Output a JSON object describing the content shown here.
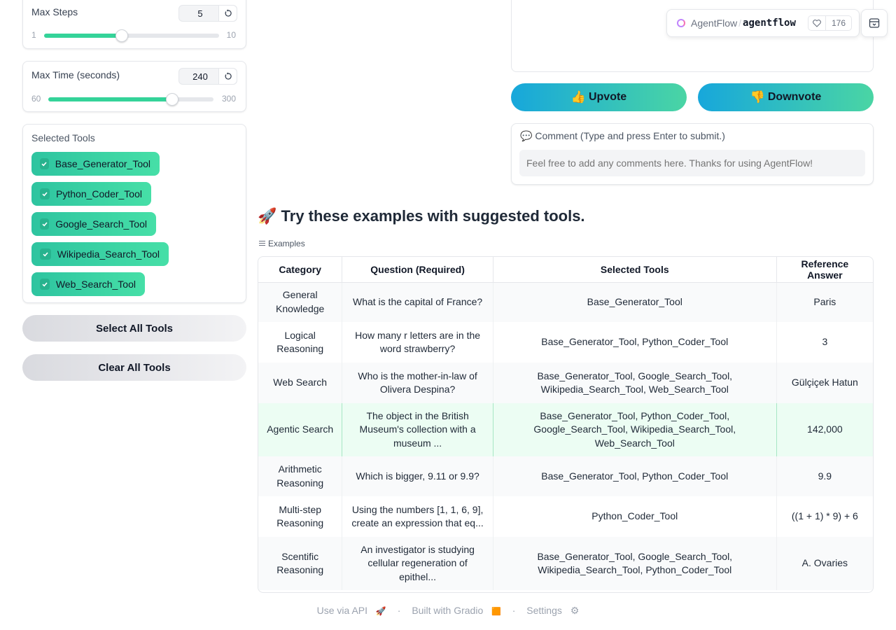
{
  "max_steps": {
    "label": "Max Steps",
    "value": "5",
    "min": "1",
    "max": "10",
    "fraction": 0.444
  },
  "max_time": {
    "label": "Max Time (seconds)",
    "value": "240",
    "min": "60",
    "max": "300",
    "fraction": 0.75
  },
  "tools": {
    "label": "Selected Tools",
    "items": [
      "Base_Generator_Tool",
      "Python_Coder_Tool",
      "Google_Search_Tool",
      "Wikipedia_Search_Tool",
      "Web_Search_Tool"
    ]
  },
  "buttons": {
    "select_all": "Select All Tools",
    "clear_all": "Clear All Tools"
  },
  "header": {
    "org": "AgentFlow",
    "separator": "/",
    "repo": "agentflow",
    "likes": "176"
  },
  "vote": {
    "upvote_emoji": "👍",
    "upvote": "Upvote",
    "downvote_emoji": "👎",
    "downvote": "Downvote"
  },
  "comment": {
    "emoji": "💬",
    "label": "Comment (Type and press Enter to submit.)",
    "placeholder": "Feel free to add any comments here. Thanks for using AgentFlow!"
  },
  "examples": {
    "emoji": "🚀",
    "heading": "Try these examples with suggested tools.",
    "tab_label": "Examples",
    "columns": [
      "Category",
      "Question (Required)",
      "Selected Tools",
      "Reference Answer"
    ],
    "rows": [
      {
        "category": "General Knowledge",
        "question": "What is the capital of France?",
        "tools": "Base_Generator_Tool",
        "answer": "Paris"
      },
      {
        "category": "Logical Reasoning",
        "question": "How many r letters are in the word strawberry?",
        "tools": "Base_Generator_Tool, Python_Coder_Tool",
        "answer": "3"
      },
      {
        "category": "Web Search",
        "question": "Who is the mother-in-law of Olivera Despina?",
        "tools": "Base_Generator_Tool, Google_Search_Tool, Wikipedia_Search_Tool, Web_Search_Tool",
        "answer": "Gülçiçek Hatun"
      },
      {
        "category": "Agentic Search",
        "question": "The object in the British Museum's collection with a museum ...",
        "tools": "Base_Generator_Tool, Python_Coder_Tool, Google_Search_Tool, Wikipedia_Search_Tool, Web_Search_Tool",
        "answer": "142,000"
      },
      {
        "category": "Arithmetic Reasoning",
        "question": "Which is bigger, 9.11 or 9.9?",
        "tools": "Base_Generator_Tool, Python_Coder_Tool",
        "answer": "9.9"
      },
      {
        "category": "Multi-step Reasoning",
        "question": "Using the numbers [1, 1, 6, 9], create an expression that eq...",
        "tools": "Python_Coder_Tool",
        "answer": "((1 + 1) * 9) + 6"
      },
      {
        "category": "Scentific Reasoning",
        "question": "An investigator is studying cellular regeneration of epithel...",
        "tools": "Base_Generator_Tool, Google_Search_Tool, Wikipedia_Search_Tool, Python_Coder_Tool",
        "answer": "A. Ovaries"
      }
    ]
  },
  "footer": {
    "api": "Use via API",
    "api_emoji": "🚀",
    "dot": "·",
    "built": "Built with Gradio",
    "built_emoji": "🟧",
    "settings": "Settings",
    "settings_emoji": "⚙"
  }
}
